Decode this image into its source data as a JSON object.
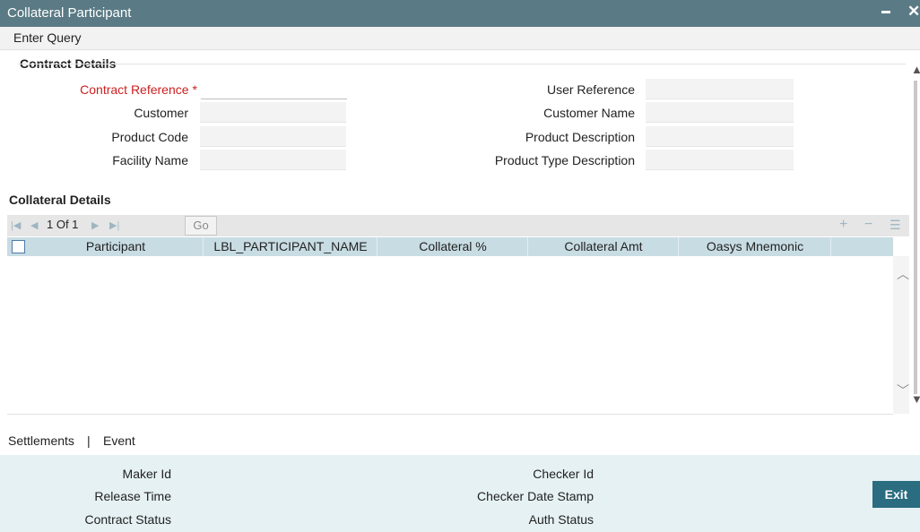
{
  "window": {
    "title": "Collateral Participant"
  },
  "menu": {
    "enter_query": "Enter Query"
  },
  "contract_details": {
    "heading": "Contract Details",
    "contract_reference_label": "Contract Reference",
    "required_marker": "*",
    "customer_label": "Customer",
    "product_code_label": "Product Code",
    "facility_name_label": "Facility Name",
    "user_reference_label": "User Reference",
    "customer_name_label": "Customer Name",
    "product_description_label": "Product Description",
    "product_type_description_label": "Product Type Description",
    "values": {
      "contract_reference": "",
      "customer": "",
      "product_code": "",
      "facility_name": "",
      "user_reference": "",
      "customer_name": "",
      "product_description": "",
      "product_type_description": ""
    }
  },
  "collateral_details": {
    "heading": "Collateral Details",
    "pager": {
      "page_text": "1 Of 1",
      "go_label": "Go"
    },
    "columns": [
      "Participant",
      "LBL_PARTICIPANT_NAME",
      "Collateral %",
      "Collateral Amt",
      "Oasys Mnemonic"
    ],
    "rows": []
  },
  "links": {
    "settlements": "Settlements",
    "separator": "|",
    "event": "Event"
  },
  "audit": {
    "maker_id_label": "Maker Id",
    "release_time_label": "Release Time",
    "contract_status_label": "Contract Status",
    "checker_id_label": "Checker Id",
    "checker_date_stamp_label": "Checker Date Stamp",
    "auth_status_label": "Auth Status"
  },
  "buttons": {
    "exit": "Exit"
  },
  "icons": {
    "minimize": "minimize-icon",
    "close": "close-icon",
    "first_page": "first-page-icon",
    "prev_page": "prev-page-icon",
    "next_page": "next-page-icon",
    "last_page": "last-page-icon",
    "add_row": "plus-icon",
    "delete_row": "minus-icon",
    "single_view": "list-icon"
  },
  "colors": {
    "titlebar": "#5a7a85",
    "table_header": "#c8dce3",
    "footer": "#e6f1f4",
    "exit_button": "#2a6c80",
    "required_label": "#cc1f1f"
  }
}
